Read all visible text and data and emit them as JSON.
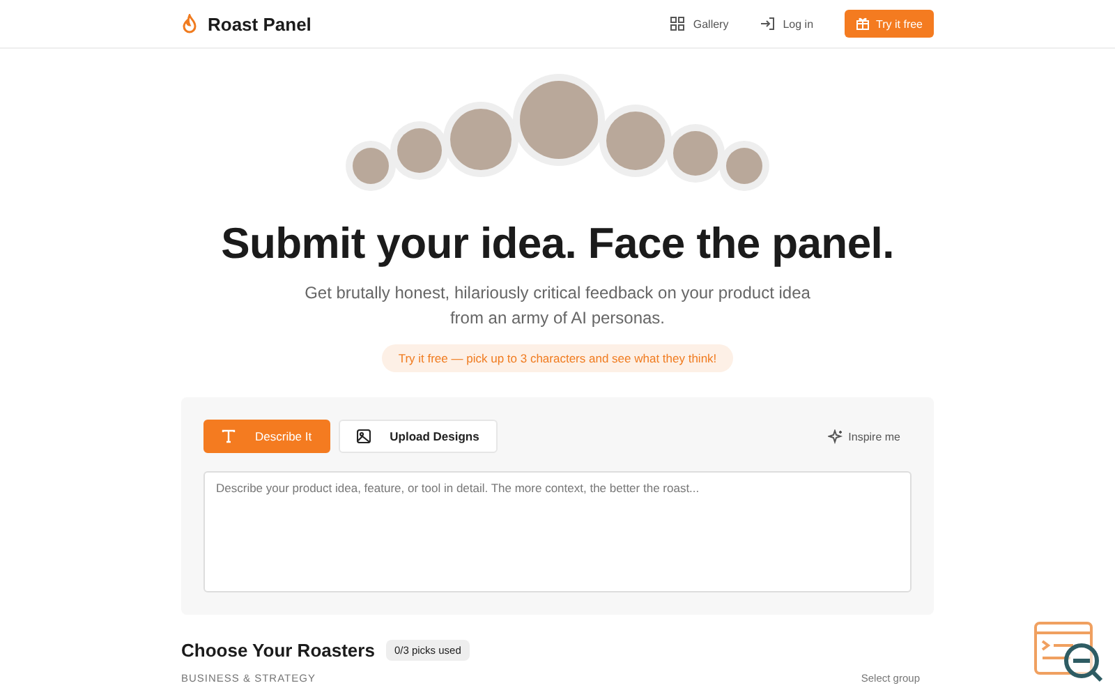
{
  "header": {
    "brand": "Roast Panel",
    "nav": [
      {
        "label": "Gallery",
        "kind": "grid"
      },
      {
        "label": "Log in",
        "kind": "login"
      }
    ],
    "cta": "Try it free"
  },
  "hero": {
    "title": "Submit your idea. Face the panel.",
    "subtitle": "Get brutally honest, hilariously critical feedback on your product idea from an army of AI personas.",
    "pill": "Try it free — pick up to 3 characters and see what they think!"
  },
  "composer": {
    "tabs": [
      {
        "label": "Describe It",
        "kind": "text",
        "selected": true
      },
      {
        "label": "Upload Designs",
        "kind": "image",
        "selected": false
      }
    ],
    "inspire": "Inspire me",
    "placeholder": "Describe your product idea, feature, or tool in detail. The more context, the better the roast..."
  },
  "roasters": {
    "title": "Choose Your Roasters",
    "badge": "0/3 picks used",
    "group": "BUSINESS & STRATEGY",
    "select": "Select group"
  }
}
